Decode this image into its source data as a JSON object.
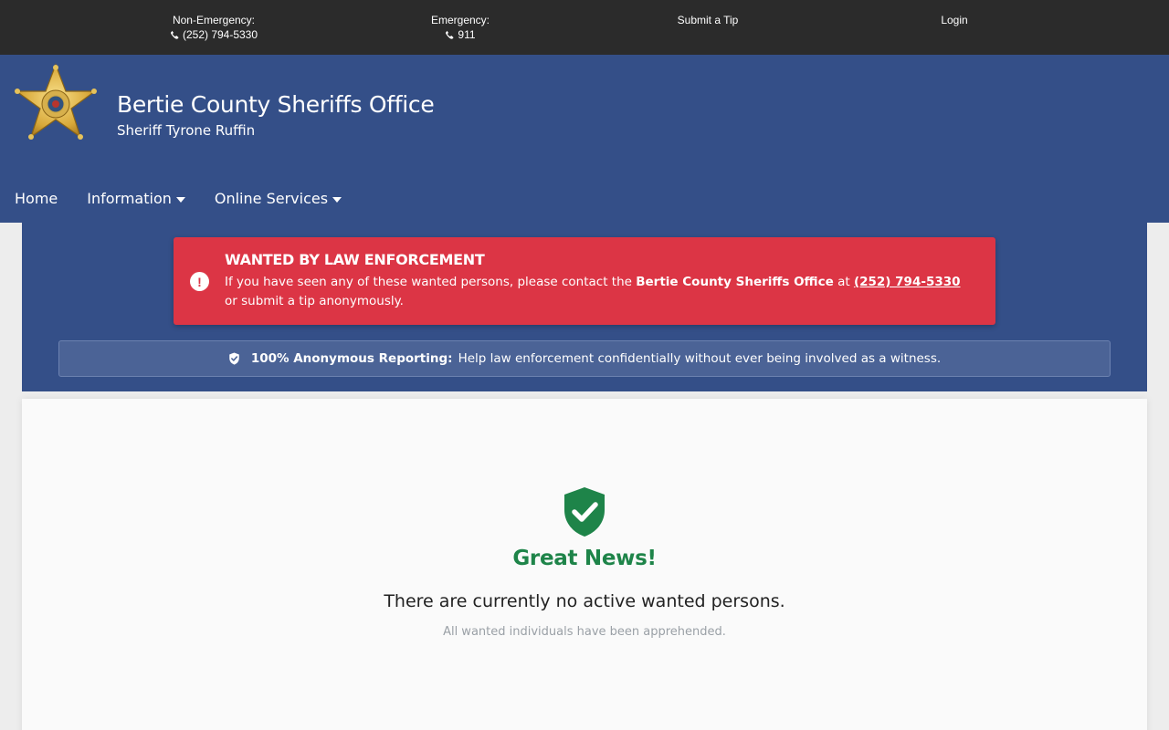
{
  "topbar": {
    "non_emergency_label": "Non-Emergency:",
    "non_emergency_phone": "(252) 794-5330",
    "emergency_label": "Emergency:",
    "emergency_phone": "911",
    "tip_link": "Submit a Tip",
    "login_link": "Login"
  },
  "header": {
    "title": "Bertie County Sheriffs Office",
    "subtitle": "Sheriff Tyrone Ruffin",
    "logo_text": "SHERIFF"
  },
  "nav": {
    "home": "Home",
    "information": "Information",
    "online_services": "Online Services"
  },
  "alert": {
    "title": "WANTED BY LAW ENFORCEMENT",
    "text_before": "If you have seen any of these wanted persons, please contact the ",
    "office": "Bertie County Sheriffs Office",
    "text_at": " at ",
    "phone": "(252) 794-5330",
    "text_after": " or submit a tip anonymously."
  },
  "anonymous": {
    "bold": "100% Anonymous Reporting:",
    "text": "Help law enforcement confidentially without ever being involved as a witness."
  },
  "status": {
    "heading": "Great News!",
    "message": "There are currently no active wanted persons.",
    "submessage": "All wanted individuals have been apprehended."
  },
  "colors": {
    "topbar": "#2b2b2b",
    "header": "#344f88",
    "alert": "#dc3545",
    "success": "#1e8449"
  }
}
